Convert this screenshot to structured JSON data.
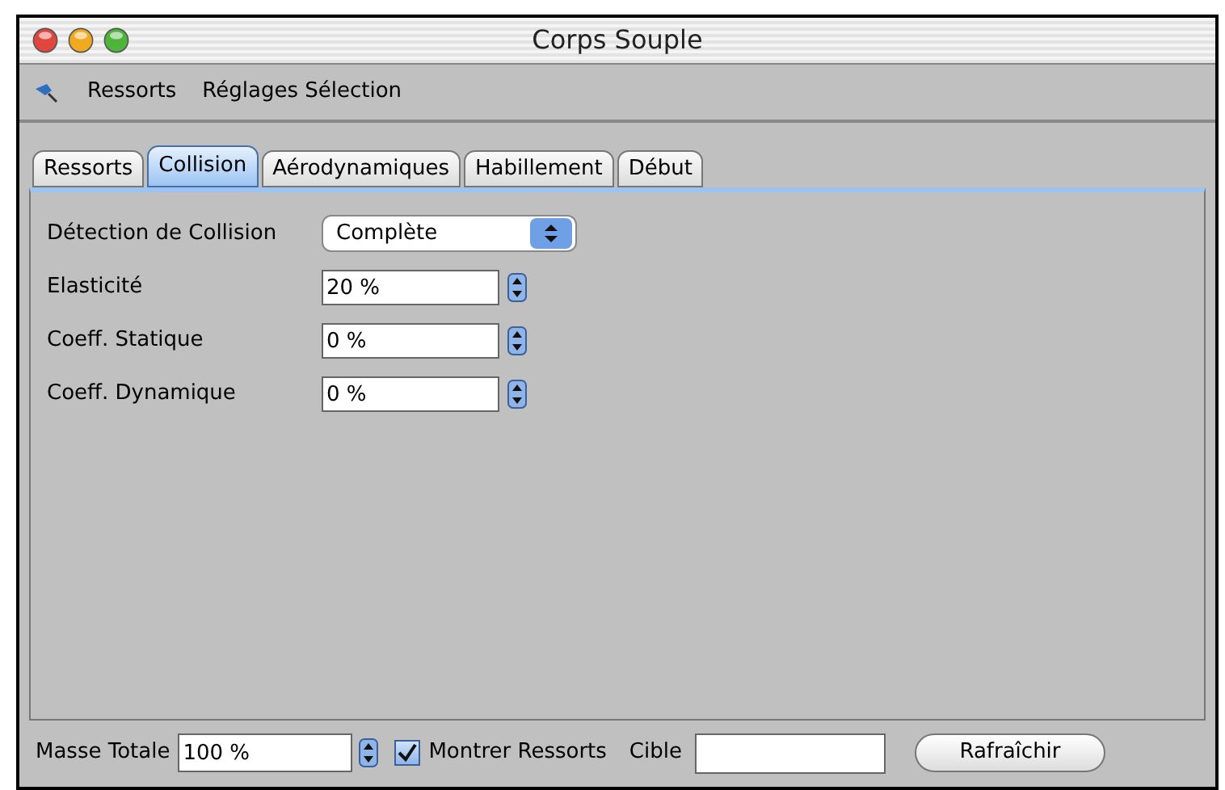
{
  "window": {
    "title": "Corps Souple"
  },
  "menu": [
    "Ressorts",
    "Réglages Sélection"
  ],
  "tabs": [
    {
      "label": "Ressorts",
      "selected": false
    },
    {
      "label": "Collision",
      "selected": true
    },
    {
      "label": "Aérodynamiques",
      "selected": false
    },
    {
      "label": "Habillement",
      "selected": false
    },
    {
      "label": "Début",
      "selected": false
    }
  ],
  "fields": [
    {
      "label": "Détection de Collision",
      "kind": "select",
      "value": "Complète"
    },
    {
      "label": "Elasticité",
      "kind": "spinner",
      "value": "20 %"
    },
    {
      "label": "Coeff. Statique",
      "kind": "spinner",
      "value": "0 %"
    },
    {
      "label": "Coeff. Dynamique",
      "kind": "spinner",
      "value": "0 %"
    }
  ],
  "footer": {
    "mass_label": "Masse Totale",
    "mass_value": "100 %",
    "show_springs": {
      "label": "Montrer Ressorts",
      "checked": true
    },
    "target_label": "Cible",
    "refresh_button": "Rafraîchir"
  }
}
